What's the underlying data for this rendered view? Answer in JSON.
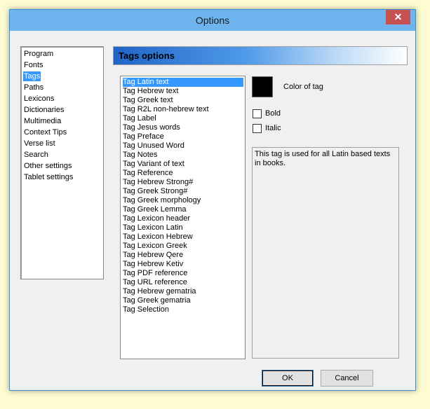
{
  "window": {
    "title": "Options",
    "close_glyph": "✕"
  },
  "nav": {
    "items": [
      {
        "label": "Program"
      },
      {
        "label": "Fonts"
      },
      {
        "label": "Tags",
        "selected": true
      },
      {
        "label": "Paths"
      },
      {
        "label": "Lexicons"
      },
      {
        "label": "Dictionaries"
      },
      {
        "label": "Multimedia"
      },
      {
        "label": "Context Tips"
      },
      {
        "label": "Verse list"
      },
      {
        "label": "Search"
      },
      {
        "label": "Other settings"
      },
      {
        "label": "Tablet settings"
      }
    ]
  },
  "panel": {
    "header": "Tags options",
    "tags": [
      {
        "label": "Tag Latin text",
        "selected": true
      },
      {
        "label": "Tag Hebrew text"
      },
      {
        "label": "Tag Greek text"
      },
      {
        "label": "Tag R2L non-hebrew text"
      },
      {
        "label": "Tag Label"
      },
      {
        "label": "Tag Jesus words"
      },
      {
        "label": "Tag Preface"
      },
      {
        "label": "Tag Unused Word"
      },
      {
        "label": "Tag Notes"
      },
      {
        "label": "Tag Variant of text"
      },
      {
        "label": "Tag Reference"
      },
      {
        "label": "Tag Hebrew Strong#"
      },
      {
        "label": "Tag Greek Strong#"
      },
      {
        "label": "Tag Greek morphology"
      },
      {
        "label": "Tag Greek Lemma"
      },
      {
        "label": "Tag Lexicon header"
      },
      {
        "label": "Tag Lexicon Latin"
      },
      {
        "label": "Tag Lexicon Hebrew"
      },
      {
        "label": "Tag Lexicon Greek"
      },
      {
        "label": "Tag Hebrew Qere"
      },
      {
        "label": "Tag Hebrew Ketiv"
      },
      {
        "label": "Tag PDF reference"
      },
      {
        "label": "Tag URL reference"
      },
      {
        "label": "Tag Hebrew gematria"
      },
      {
        "label": "Tag Greek gematria"
      },
      {
        "label": "Tag Selection"
      }
    ],
    "color_label": "Color of tag",
    "color_value": "#000000",
    "bold_label": "Bold",
    "bold_checked": false,
    "italic_label": "Italic",
    "italic_checked": false,
    "description": "This tag is used for all Latin based texts in books."
  },
  "buttons": {
    "ok": "OK",
    "cancel": "Cancel"
  }
}
